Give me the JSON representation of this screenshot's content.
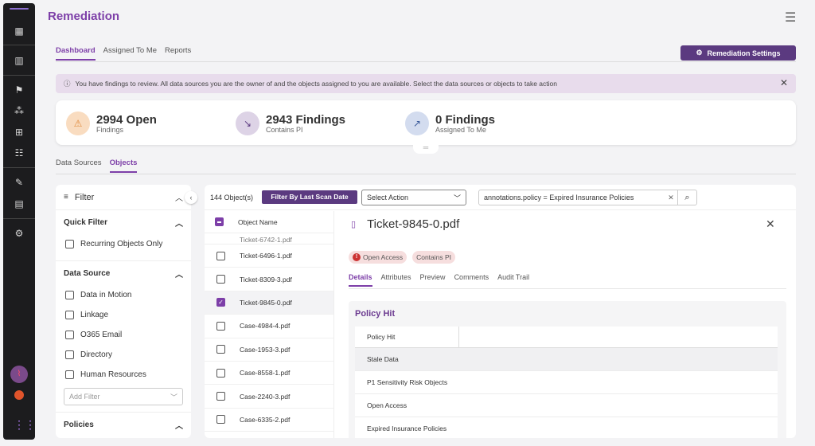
{
  "app": {
    "title": "Remediation"
  },
  "nav_tabs": [
    {
      "label": "Dashboard",
      "active": true
    },
    {
      "label": "Assigned To Me",
      "active": false
    },
    {
      "label": "Reports",
      "active": false
    }
  ],
  "settings_button": {
    "label": "Remediation Settings"
  },
  "banner": {
    "text": "You have findings to review. All data sources you are the owner of and the objects assigned to you are available. Select the data sources or objects to take action"
  },
  "stats": [
    {
      "value": "2994 Open",
      "label": "Findings",
      "icon": "warning-icon",
      "color": "#f9dcc0"
    },
    {
      "value": "2943 Findings",
      "label": "Contains PI",
      "icon": "trend-down-icon",
      "color": "#ddd3e6"
    },
    {
      "value": "0 Findings",
      "label": "Assigned To Me",
      "icon": "trend-up-icon",
      "color": "#d3dcef"
    }
  ],
  "sub_tabs": [
    {
      "label": "Data Sources",
      "active": false
    },
    {
      "label": "Objects",
      "active": true
    }
  ],
  "filter": {
    "title": "Filter",
    "quick_filter": {
      "title": "Quick Filter",
      "items": [
        "Recurring Objects Only"
      ]
    },
    "data_source": {
      "title": "Data Source",
      "items": [
        "Data in Motion",
        "Linkage",
        "O365 Email",
        "Directory",
        "Human Resources"
      ]
    },
    "add_filter_placeholder": "Add Filter",
    "policies": {
      "title": "Policies"
    }
  },
  "toolbar": {
    "count": "144 Object(s)",
    "scan_button": "Filter By Last Scan Date",
    "select_action": "Select Action",
    "search_value": "annotations.policy = Expired Insurance Policies"
  },
  "objects": {
    "header": "Object Name",
    "partial_row": "Ticket-6742-1.pdf",
    "rows": [
      {
        "name": "Ticket-6496-1.pdf",
        "checked": false
      },
      {
        "name": "Ticket-8309-3.pdf",
        "checked": false
      },
      {
        "name": "Ticket-9845-0.pdf",
        "checked": true
      },
      {
        "name": "Case-4984-4.pdf",
        "checked": false
      },
      {
        "name": "Case-1953-3.pdf",
        "checked": false
      },
      {
        "name": "Case-8558-1.pdf",
        "checked": false
      },
      {
        "name": "Case-2240-3.pdf",
        "checked": false
      },
      {
        "name": "Case-6335-2.pdf",
        "checked": false
      }
    ]
  },
  "detail": {
    "title": "Ticket-9845-0.pdf",
    "badges": [
      {
        "label": "Open Access",
        "has_error_icon": true
      },
      {
        "label": "Contains PI",
        "has_error_icon": false
      }
    ],
    "tabs": [
      {
        "label": "Details",
        "active": true
      },
      {
        "label": "Attributes",
        "active": false
      },
      {
        "label": "Preview",
        "active": false
      },
      {
        "label": "Comments",
        "active": false
      },
      {
        "label": "Audit Trail",
        "active": false
      }
    ],
    "policy_hit": {
      "heading": "Policy Hit",
      "column": "Policy Hit",
      "rows": [
        "Stale Data",
        "P1 Sensitivity Risk Objects",
        "Open Access",
        "Expired Insurance Policies"
      ]
    }
  },
  "colors": {
    "accent": "#7d3fa8",
    "button": "#5b3a80",
    "banner": "#e8dcec"
  }
}
